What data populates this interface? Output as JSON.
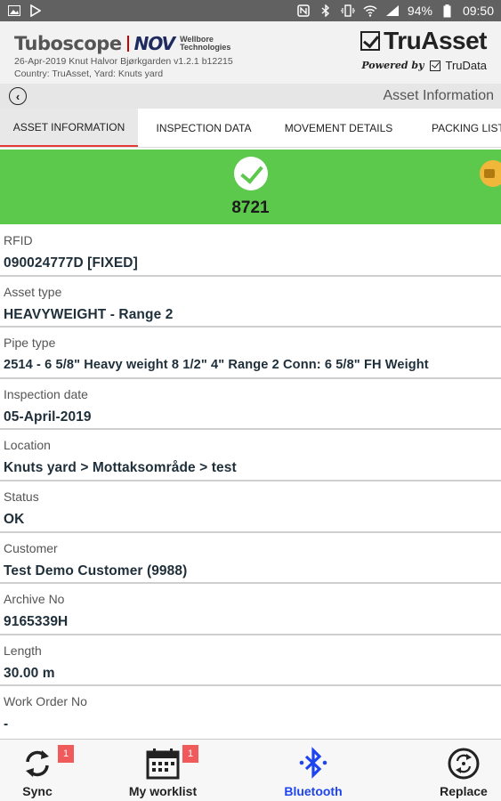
{
  "status_bar": {
    "battery": "94%",
    "time": "09:50"
  },
  "header": {
    "brand_tubo": "Tuboscope",
    "brand_nov": "NOV",
    "brand_wbt_line1": "Wellbore",
    "brand_wbt_line2": "Technologies",
    "meta_line1": "26-Apr-2019   Knut Halvor Bjørkgarden   v1.2.1 b12215",
    "meta_line2": "Country: TruAsset, Yard: Knuts yard",
    "truasset": "TruAsset",
    "powered_by": "Powered by",
    "trudata": "TruData"
  },
  "titlebar": {
    "title": "Asset Information"
  },
  "tabs": [
    {
      "label": "ASSET INFORMATION",
      "active": true
    },
    {
      "label": "INSPECTION DATA",
      "active": false
    },
    {
      "label": "MOVEMENT DETAILS",
      "active": false
    },
    {
      "label": "PACKING LIST",
      "active": false
    }
  ],
  "banner": {
    "number": "8721",
    "color": "#5cc84c"
  },
  "fields": [
    {
      "label": "RFID",
      "value": "090024777D   [FIXED]"
    },
    {
      "label": "Asset type",
      "value": "HEAVYWEIGHT - Range 2"
    },
    {
      "label": "Pipe type",
      "value": "2514 - 6 5/8\" Heavy weight 8 1/2\" 4\" Range 2 Conn: 6 5/8\" FH Weight"
    },
    {
      "label": "Inspection date",
      "value": "05-April-2019"
    },
    {
      "label": "Location",
      "value": "Knuts yard > Mottaksområde > test"
    },
    {
      "label": "Status",
      "value": "OK"
    },
    {
      "label": "Customer",
      "value": "Test Demo Customer (9988)"
    },
    {
      "label": "Archive No",
      "value": "9165339H"
    },
    {
      "label": "Length",
      "value": "30.00 m"
    },
    {
      "label": "Work Order No",
      "value": "-"
    }
  ],
  "bottom_nav": {
    "sync_label": "Sync",
    "sync_badge": "1",
    "worklist_label": "My worklist",
    "worklist_badge": "1",
    "bluetooth_label": "Bluetooth",
    "replace_label": "Replace",
    "active_color": "#1e44ee"
  }
}
